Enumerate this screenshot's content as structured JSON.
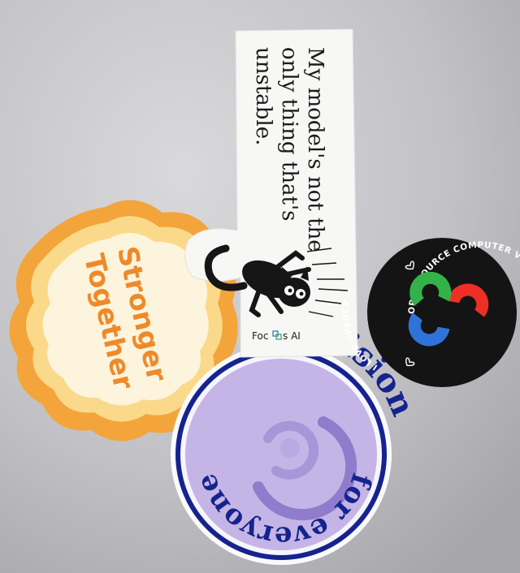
{
  "stickers": {
    "stronger": {
      "line1": "Stronger",
      "line2": "Together",
      "colors": {
        "outer": "#f3a53b",
        "mid": "#fbd98a",
        "inner": "#fdf4dd",
        "text": "#ee8a2a"
      }
    },
    "quote": {
      "line1": "My model's not the",
      "line2": "only thing that's",
      "line3": "unstable.",
      "brand_prefix": "Foc",
      "brand_suffix": "s AI",
      "colors": {
        "paper": "#f7f7f5",
        "text": "#1b1b1b",
        "cat": "#161616"
      }
    },
    "vision": {
      "arc_outer": "Vision",
      "arc_inner": "for everyone",
      "colors": {
        "ring": "#15238e",
        "face": "#c5b5e6",
        "text": "#15238e",
        "swirl": "#8f7ccc"
      }
    },
    "opencv": {
      "arc_top": "OPEN SOURCE COMPUTER VISION LIBRARY",
      "arc_left": "I LOVE OPENCV",
      "colors": {
        "bg": "#141414",
        "text": "#ffffff",
        "red": "#ef2f25",
        "green": "#34b24a",
        "blue": "#2f73d8"
      }
    }
  }
}
